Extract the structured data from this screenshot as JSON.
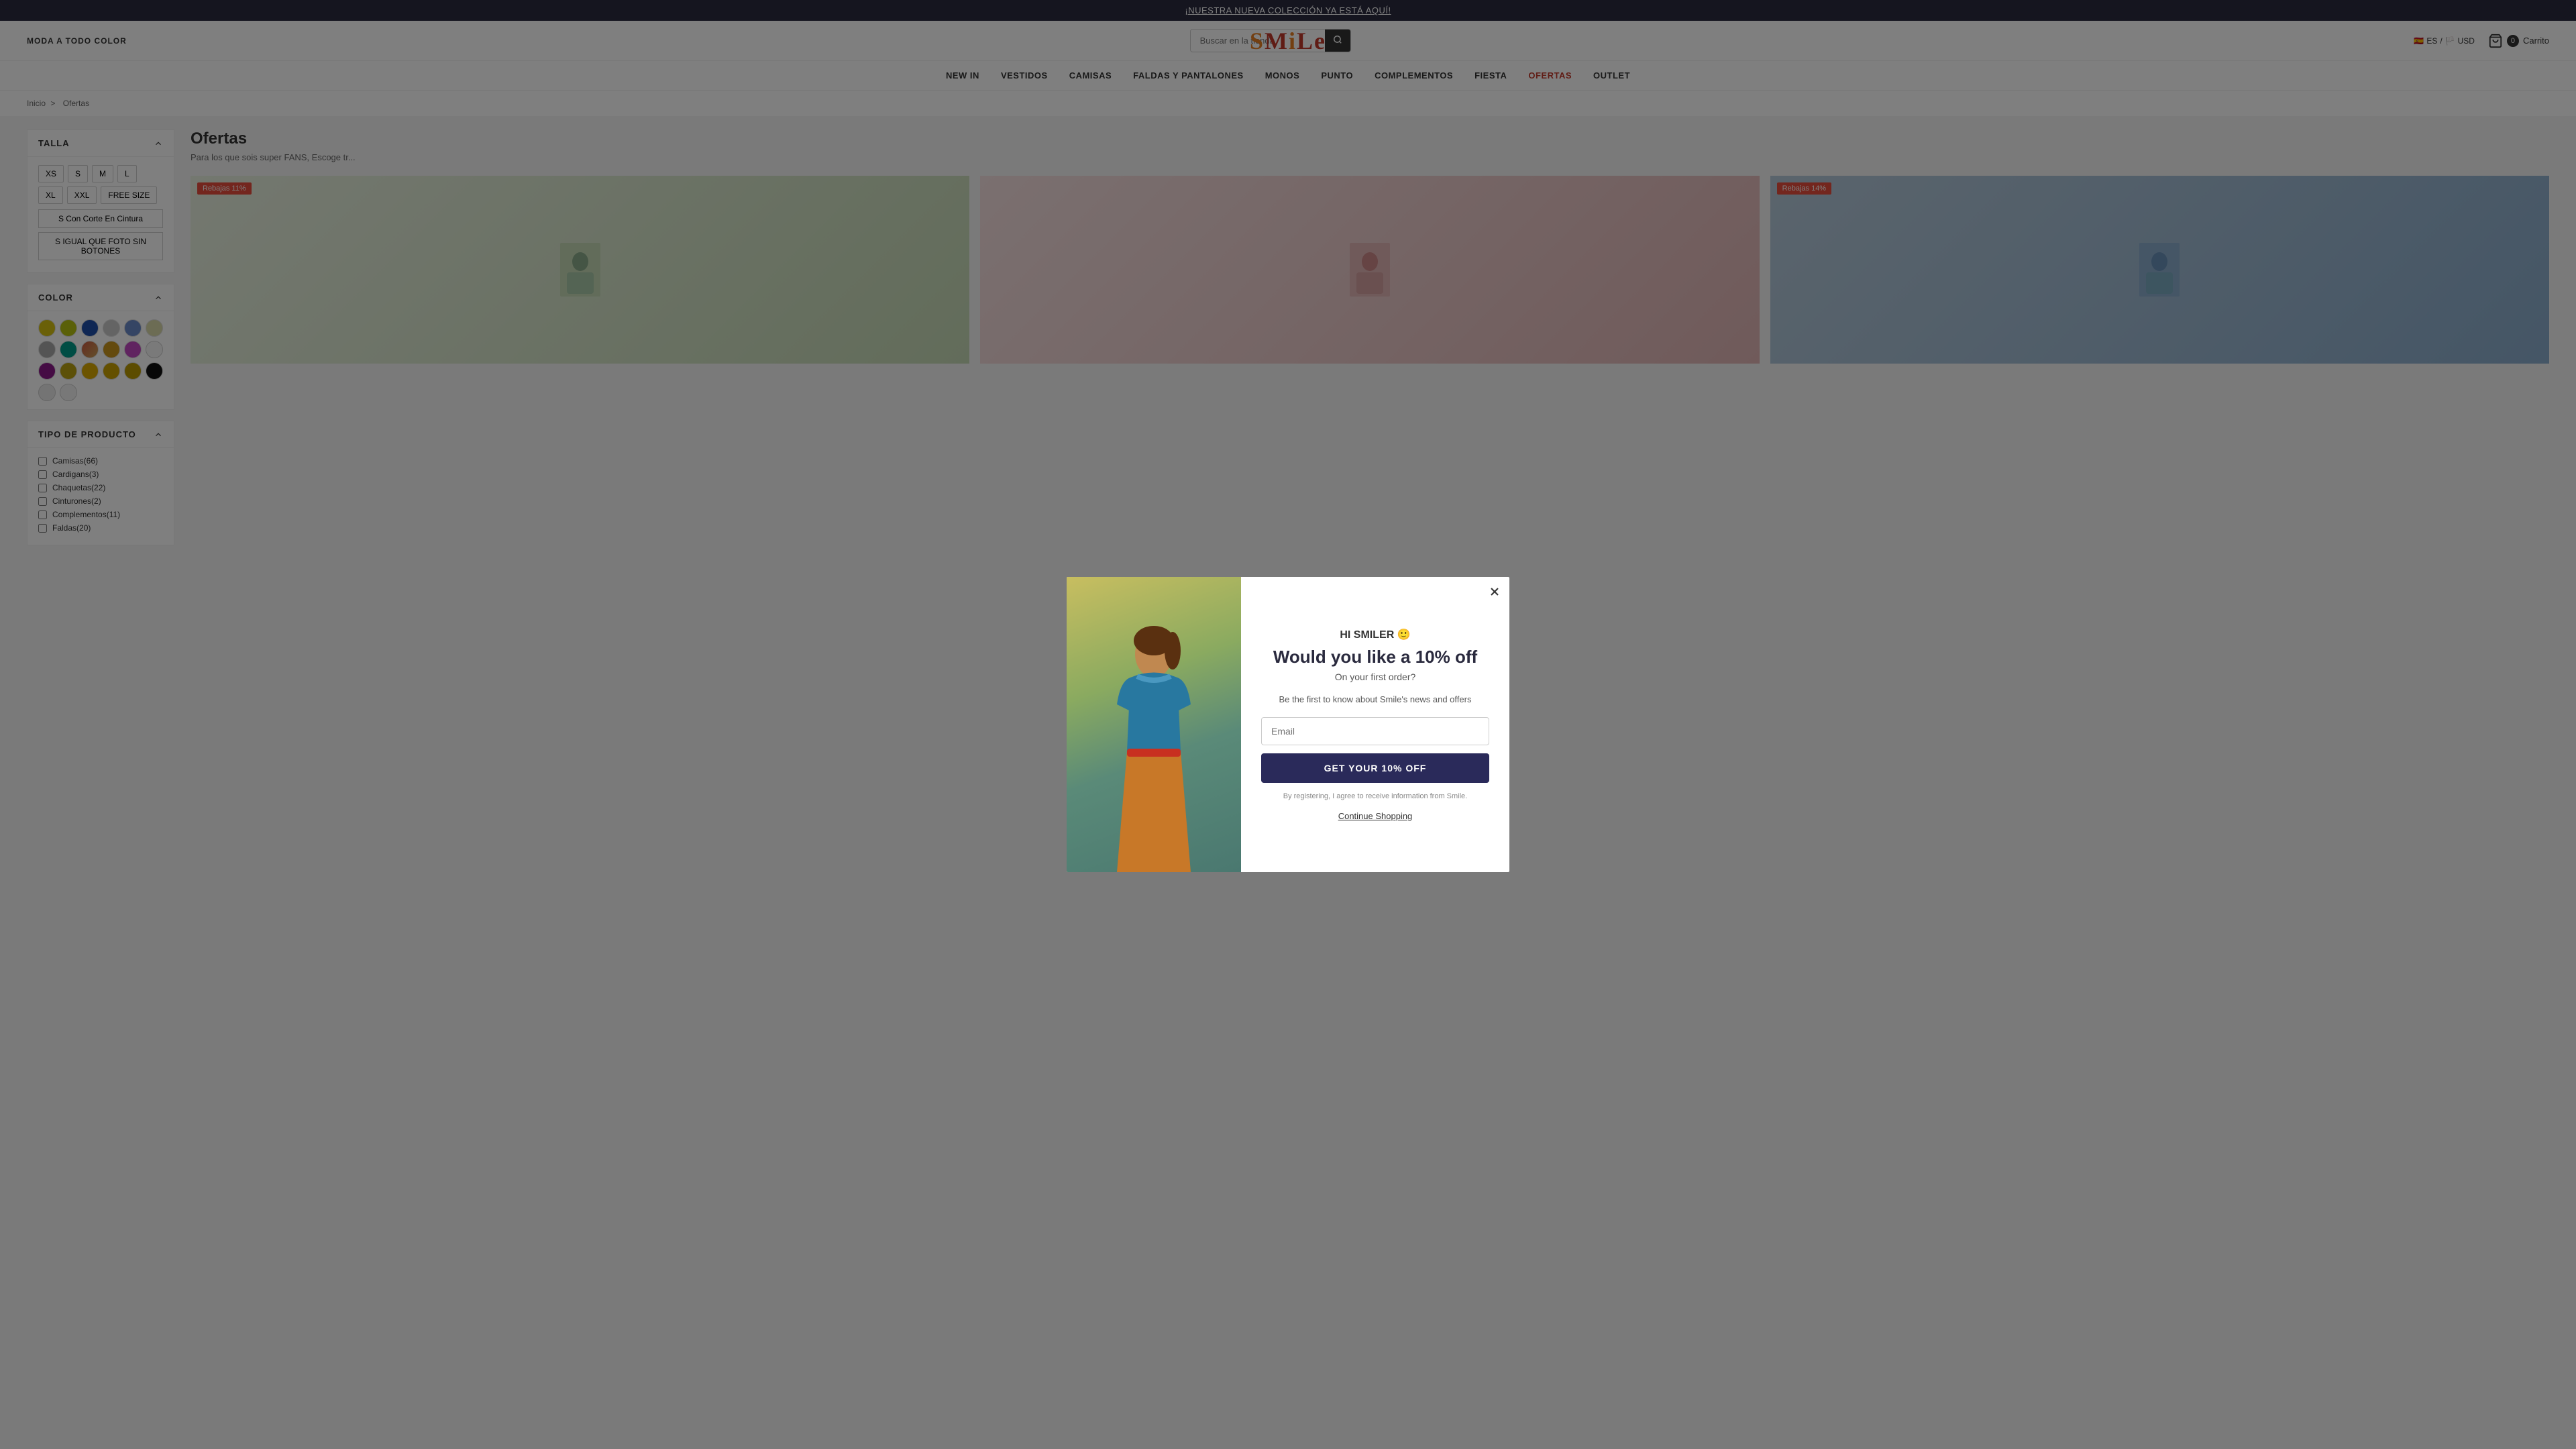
{
  "topBanner": {
    "text": "¡NUESTRA NUEVA COLECCIÓN YA ESTÁ AQUÍ!"
  },
  "header": {
    "brand": "MODA A TODO COLOR",
    "logo": "SMiLe",
    "search": {
      "placeholder": "Buscar en la tienda"
    },
    "language": "ES",
    "currency": "USD",
    "cart": {
      "count": "0",
      "label": "Carrito"
    }
  },
  "nav": {
    "items": [
      {
        "label": "NEW IN"
      },
      {
        "label": "VESTIDOS"
      },
      {
        "label": "CAMISAS"
      },
      {
        "label": "FALDAS Y PANTALONES"
      },
      {
        "label": "MONOS"
      },
      {
        "label": "PUNTO"
      },
      {
        "label": "COMPLEMENTOS"
      },
      {
        "label": "FIESTA"
      },
      {
        "label": "OFERTAS"
      },
      {
        "label": "OUTLET"
      }
    ]
  },
  "breadcrumb": {
    "home": "Inicio",
    "separator": ">",
    "current": "Ofertas"
  },
  "sidebar": {
    "talla": {
      "title": "TALLA",
      "sizes": [
        "XS",
        "S",
        "M",
        "L",
        "XL",
        "XXL",
        "FREE SIZE"
      ],
      "special": [
        "S Con Corte En Cintura",
        "S IGUAL QUE FOTO SIN BOTONES"
      ]
    },
    "color": {
      "title": "COLOR",
      "swatches": [
        "#d4c010",
        "#b5c010",
        "#1e4fa8",
        "#c8c8c8",
        "#6a8ac8",
        "#d8d8a8",
        "#a8a8a8",
        "#009a88",
        "#c85840",
        "#c8941c",
        "#c048c0",
        "#f5f5f5",
        "#8a1888",
        "#b8a010",
        "#d8a800",
        "#c8a000",
        "#b89800",
        "#101010",
        "#e8e8e8",
        "#f0f0f0"
      ]
    },
    "tipoProducto": {
      "title": "TIPO DE PRODUCTO",
      "items": [
        {
          "label": "Camisas",
          "count": 66
        },
        {
          "label": "Cardigans",
          "count": 3
        },
        {
          "label": "Chaquetas",
          "count": 22
        },
        {
          "label": "Cinturones",
          "count": 2
        },
        {
          "label": "Complementos",
          "count": 11
        },
        {
          "label": "Faldas",
          "count": 20
        }
      ]
    }
  },
  "content": {
    "title": "Ofertas",
    "description": "Para los que sois super FANS, Escoge tr...",
    "products": [
      {
        "badge": "Rebajas 11%",
        "img": "1"
      },
      {
        "badge": "",
        "img": "2"
      },
      {
        "badge": "Rebajas 14%",
        "img": "3"
      }
    ]
  },
  "modal": {
    "greeting": "HI SMILER 🙂",
    "headline": "Would you like a 10% off",
    "subheadline": "On your first order?",
    "description": "Be the first to know about Smile's news and offers",
    "emailPlaceholder": "Email",
    "ctaButton": "GET YOUR 10% OFF",
    "disclaimer": "By registering, I agree to receive\ninformation from Smile.",
    "continueShopping": "Continue Shopping"
  }
}
